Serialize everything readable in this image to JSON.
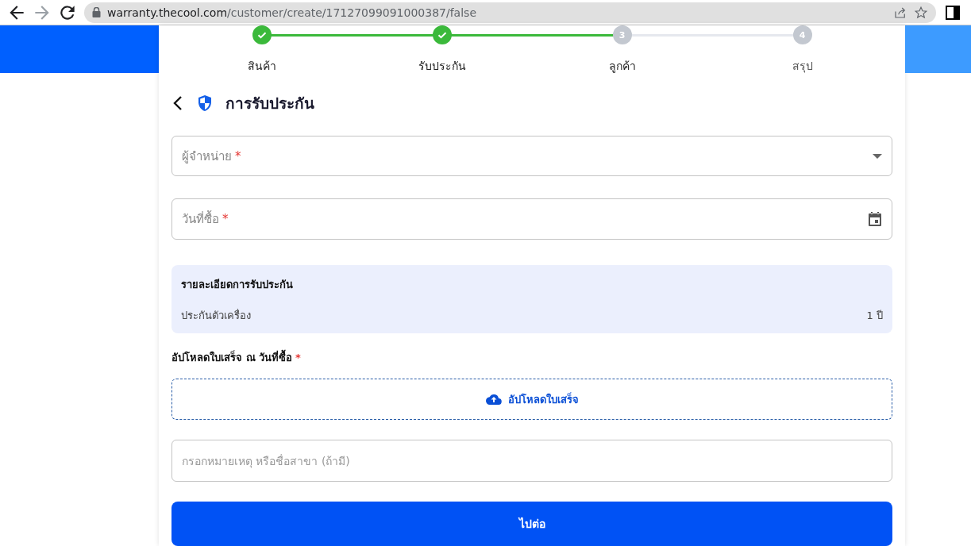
{
  "browser": {
    "url_host": "warranty.thecool.com",
    "url_path": "/customer/create/17127099091000387/false"
  },
  "steps": [
    {
      "label": "สินค้า",
      "done": true
    },
    {
      "label": "รับประกัน",
      "done": true
    },
    {
      "label": "ลูกค้า",
      "number": "3",
      "done": false
    },
    {
      "label": "สรุป",
      "number": "4",
      "done": false
    }
  ],
  "title": "การรับประกัน",
  "fields": [
    {
      "kind": "dropdown",
      "label": "ผู้จำหน่าย",
      "required_mark": "*"
    },
    {
      "kind": "date",
      "label": "วันที่ซื้อ",
      "required_mark": "*"
    }
  ],
  "details": {
    "title": "รายละเอียดการรับประกัน",
    "rows": [
      {
        "label": "ประกันตัวเครื่อง",
        "value": "1 ปี"
      }
    ]
  },
  "upload": {
    "label": "อัปโหลดใบเสร็จ ณ วันที่ซื้อ",
    "required_mark": "*",
    "button": "อัปโหลดใบเสร็จ"
  },
  "notes": {
    "placeholder": "กรอกหมายเหตุ หรือชื่อสาขา (ถ้ามี)"
  },
  "next_button": "ไปต่อ"
}
